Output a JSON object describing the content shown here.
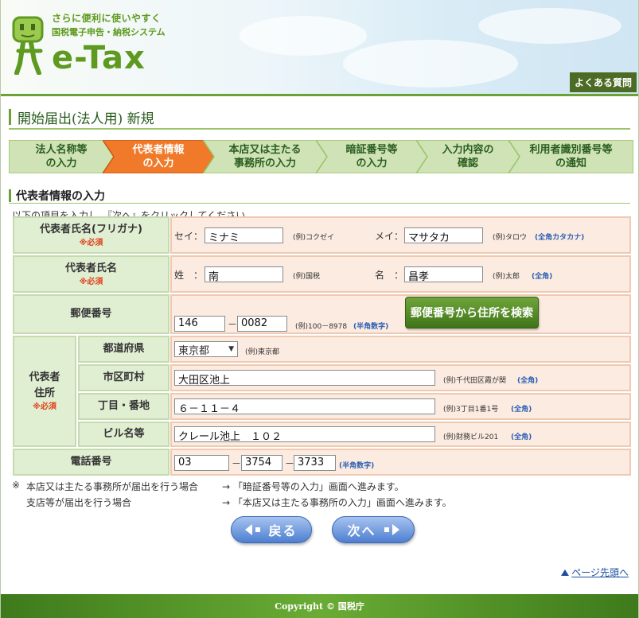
{
  "header": {
    "tagline1": "さらに便利に使いやすく",
    "tagline2": "国税電子申告・納税システム",
    "logo": "e-Tax",
    "faq": "よくある質問"
  },
  "page_title": "開始届出(法人用) 新規",
  "steps": [
    {
      "label": "法人名称等\nの入力",
      "active": false
    },
    {
      "label": "代表者情報\nの入力",
      "active": true
    },
    {
      "label": "本店又は主たる\n事務所の入力",
      "active": false
    },
    {
      "label": "暗証番号等\nの入力",
      "active": false
    },
    {
      "label": "入力内容の\n確認",
      "active": false
    },
    {
      "label": "利用者識別番号等\nの通知",
      "active": false
    }
  ],
  "section": {
    "heading": "代表者情報の入力",
    "instruction": "以下の項目を入力し、『次へ』をクリックしてください。"
  },
  "form": {
    "required": "※必須",
    "kana": {
      "label": "代表者氏名(フリガナ)",
      "sei_label": "セイ：",
      "sei_value": "ミナミ",
      "sei_example": "(例)コクゼイ",
      "mei_label": "メイ：",
      "mei_value": "マサタカ",
      "mei_example": "(例)タロウ",
      "hint": "(全角カタカナ)"
    },
    "name": {
      "label": "代表者氏名",
      "sei_label": "姓　：",
      "sei_value": "南",
      "sei_example": "(例)国税",
      "mei_label": "名　：",
      "mei_value": "昌孝",
      "mei_example": "(例)太郎",
      "hint": "(全角)"
    },
    "zip": {
      "label": "郵便番号",
      "part1": "146",
      "dash": "－",
      "part2": "0082",
      "example": "(例)100－8978",
      "hint": "(半角数字)",
      "search_button": "郵便番号から住所を検索"
    },
    "address": {
      "label_line1": "代表者",
      "label_line2": "住所",
      "prefecture": {
        "label": "都道府県",
        "value": "東京都",
        "example": "(例)東京都"
      },
      "city": {
        "label": "市区町村",
        "value": "大田区池上",
        "example": "(例)千代田区霞が関",
        "hint": "(全角)"
      },
      "street": {
        "label": "丁目・番地",
        "value": "６－１１－４",
        "example": "(例)3丁目1番1号",
        "hint": "(全角)"
      },
      "building": {
        "label": "ビル名等",
        "value": "クレール池上　１０２",
        "example": "(例)財務ビル201",
        "hint": "(全角)"
      }
    },
    "phone": {
      "label": "電話番号",
      "part1": "03",
      "part2": "3754",
      "part3": "3733",
      "dash": "－",
      "hint": "(半角数字)"
    }
  },
  "notes": {
    "mark": "※",
    "row1_case": "本店又は主たる事務所が届出を行う場合",
    "row1_result": "→ 「暗証番号等の入力」画面へ進みます。",
    "row2_case": "支店等が届出を行う場合",
    "row2_result": "→ 「本店又は主たる事務所の入力」画面へ進みます。"
  },
  "nav": {
    "back": "戻る",
    "next": "次へ"
  },
  "page_top": "ページ先頭へ",
  "footer": "Copyright © 国税庁",
  "colors": {
    "brand_green": "#6aa235",
    "step_active": "#f07a2a",
    "step_inactive": "#cfe3b6",
    "label_bg": "#e0eed2",
    "field_bg": "#fcebe0",
    "hint_blue": "#2a5fb5",
    "required_red": "#e0401a"
  }
}
